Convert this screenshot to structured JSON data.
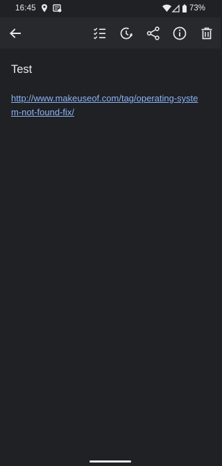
{
  "status_bar": {
    "time": "16:45",
    "battery_percent": "73%",
    "left_icons": [
      "location-icon",
      "notification-icon"
    ],
    "right_icons": [
      "wifi-icon",
      "cellular-icon",
      "battery-icon"
    ]
  },
  "toolbar": {
    "buttons": [
      "back-icon",
      "checklist-icon",
      "reminder-icon",
      "share-icon",
      "info-icon",
      "delete-icon"
    ]
  },
  "note": {
    "title": "Test",
    "link_text": "http://www.makeuseof.com/tag/operating-system-not-found-fix/"
  },
  "colors": {
    "background": "#202124",
    "toolbar": "#28292c",
    "text": "#e8eaed",
    "link": "#8ab4f8"
  }
}
